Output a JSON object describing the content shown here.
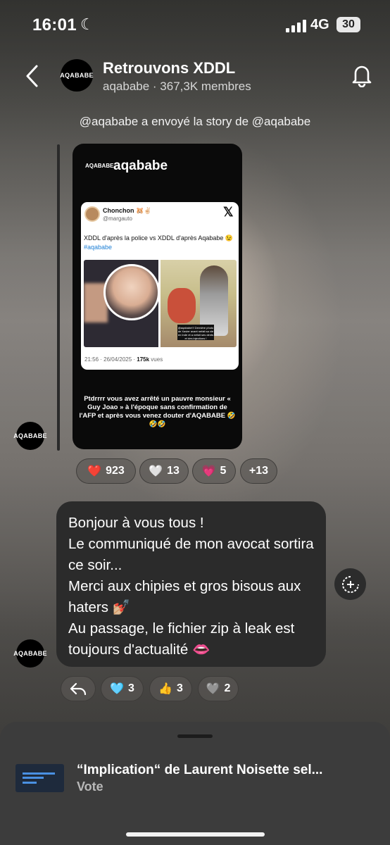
{
  "status_bar": {
    "time": "16:01",
    "network": "4G",
    "battery": "30"
  },
  "header": {
    "title": "Retrouvons XDDL",
    "subtitle": "aqababe · 367,3K membres",
    "avatar_text": "AQABABE"
  },
  "story": {
    "label": "@aqababe a envoyé la story de @aqababe",
    "account_logo": "AQABABE",
    "account_name": "aqababe",
    "tweet": {
      "name": "Chonchon 🐹✌🏻",
      "handle": "@margauto",
      "text": "XDDL d'après la police vs XDDL d'après Aqababe 😉",
      "hashtag": "#aqababe",
      "image_caption": "@aqababe!!! Dernière photo de Xavier avant nefait sa vie en Inde et a nefait ses dents et des injections !",
      "time": "21:56 · 26/04/2025 · ",
      "views_count": "175k",
      "views_label": " vues"
    },
    "caption": "Ptdrrrr vous avez arrêté un pauvre monsieur « Guy Joao » à l'époque sans confirmation de l'AFP et après vous venez douter d'AQABABE 🤣🤣🤣"
  },
  "story_reactions": [
    {
      "emoji": "❤️",
      "count": "923"
    },
    {
      "emoji": "🤍",
      "count": "13"
    },
    {
      "emoji": "💗",
      "count": "5"
    },
    {
      "emoji": "",
      "count": "+13"
    }
  ],
  "message": {
    "avatar_text": "AQABABE",
    "text": "Bonjour à vous tous !\nLe communiqué de mon avocat sortira ce soir...\nMerci aux chipies et gros bisous aux haters 💅🏼\nAu passage, le fichier zip à leak est toujours d'actualité 👄"
  },
  "message_reactions": [
    {
      "emoji": "🩵",
      "count": "3"
    },
    {
      "emoji": "👍",
      "count": "3"
    },
    {
      "emoji": "🩶",
      "count": "2"
    }
  ],
  "poll": {
    "title": "“Implication“ de Laurent Noisette sel...",
    "action": "Vote"
  },
  "colors": {
    "bubble": "#2b2b2b",
    "sheet": "#3c3c3c",
    "link": "#1d7fd6"
  }
}
